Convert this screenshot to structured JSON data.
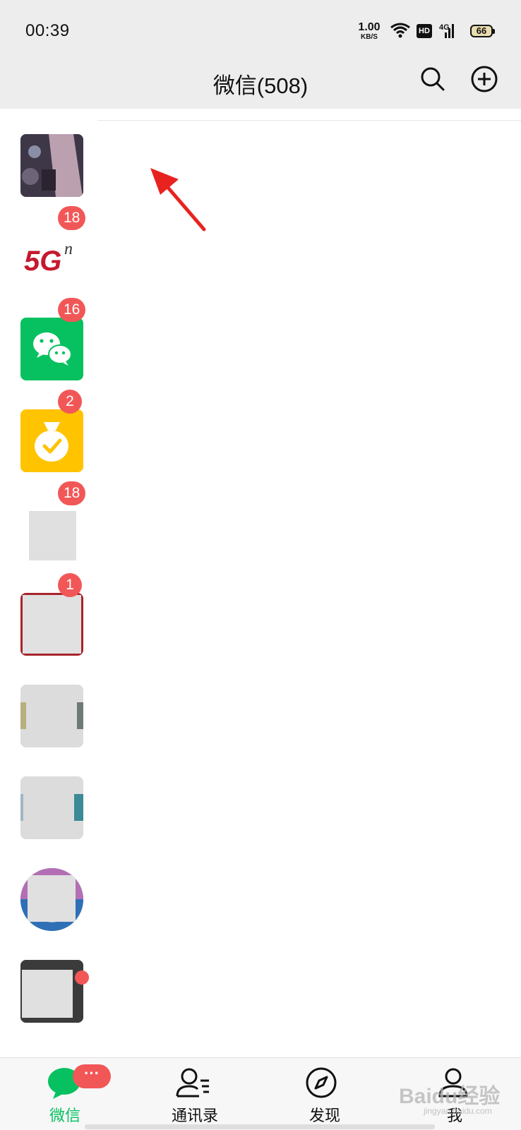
{
  "status_bar": {
    "time": "00:39",
    "net_speed": "1.00",
    "net_speed_unit": "KB/S",
    "hd": "HD",
    "network": "4G",
    "battery": "66"
  },
  "header": {
    "title": "微信(508)",
    "icons": [
      "search-icon",
      "add-icon"
    ]
  },
  "chats": [
    {
      "badge": ""
    },
    {
      "badge": "18"
    },
    {
      "badge": "16"
    },
    {
      "badge": "2"
    },
    {
      "badge": "18"
    },
    {
      "badge": "1"
    },
    {
      "badge": ""
    },
    {
      "badge": ""
    },
    {
      "badge": ""
    },
    {
      "badge": "",
      "dot": true
    }
  ],
  "tabs": [
    {
      "label": "微信",
      "badge": "···",
      "active": true
    },
    {
      "label": "通讯录"
    },
    {
      "label": "发现"
    },
    {
      "label": "我"
    }
  ],
  "watermark": {
    "text": "Baidu经验",
    "sub": "jingyan.baidu.com"
  },
  "colors": {
    "accent": "#07c160",
    "badge": "#f25757",
    "bar_bg": "#ededed",
    "arrow": "#e8231f"
  }
}
